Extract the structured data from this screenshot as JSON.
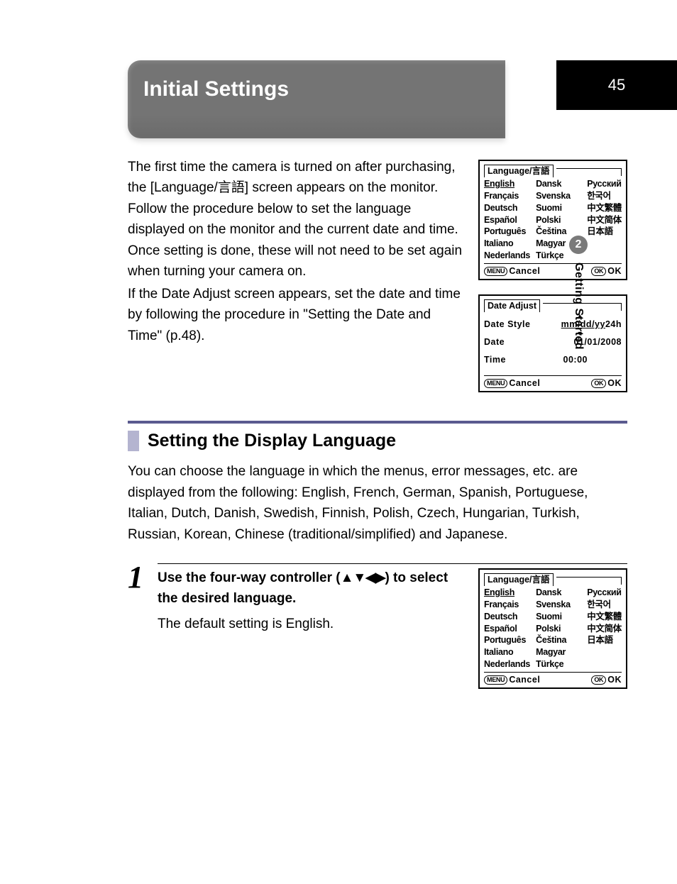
{
  "page_number": "45",
  "side_tab_number": "2",
  "side_tab_label": "Getting Started",
  "title": "Initial Settings",
  "intro_para1": "The first time the camera is turned on after purchasing, the [Language/言語] screen appears on the monitor. Follow the procedure below to set the language displayed on the monitor and the current date and time. Once setting is done, these will not need to be set again when turning your camera on.",
  "intro_para2": "If the Date Adjust screen appears, set the date and time by following the procedure in \"Setting the Date and Time\" (p.48).",
  "lang_screen": {
    "title": "Language/言語",
    "col1": [
      "English",
      "Français",
      "Deutsch",
      "Español",
      "Português",
      "Italiano",
      "Nederlands"
    ],
    "col2": [
      "Dansk",
      "Svenska",
      "Suomi",
      "Polski",
      "Čeština",
      "Magyar",
      "Türkçe"
    ],
    "col3": [
      "Русский",
      "한국어",
      "中文繁體",
      "中文简体",
      "日本語"
    ],
    "menu_btn": "MENU",
    "cancel": "Cancel",
    "ok_btn": "OK",
    "ok": "OK"
  },
  "date_screen": {
    "title": "Date Adjust",
    "rows": {
      "style_label": "Date Style",
      "style_value": "mm/dd/yy",
      "style_24h": "24h",
      "date_label": "Date",
      "date_value": "01/01/2008",
      "time_label": "Time",
      "time_value": "00:00"
    },
    "menu_btn": "MENU",
    "cancel": "Cancel",
    "ok_btn": "OK",
    "ok": "OK"
  },
  "section_heading": "Setting the Display Language",
  "section_body": "You can choose the language in which the menus, error messages, etc. are displayed from the following: English, French, German, Spanish, Portuguese, Italian, Dutch, Danish, Swedish, Finnish, Polish, Czech, Hungarian, Turkish, Russian, Korean, Chinese (traditional/simplified) and Japanese.",
  "step1": {
    "num": "1",
    "bold_a": "Use the four-way controller (",
    "arrows": "▲▼◀▶",
    "bold_b": ") to select the desired language.",
    "detail": "The default setting is English."
  }
}
